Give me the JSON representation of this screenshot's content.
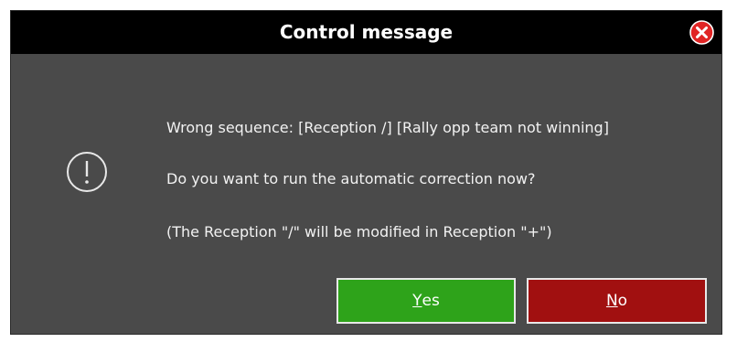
{
  "dialog": {
    "title": "Control message",
    "messages": [
      "Wrong sequence: [Reception /]  [Rally opp team not winning]",
      "Do you want to run the automatic correction now?",
      "(The Reception \"/\" will be modified in Reception \"+\")"
    ],
    "buttons": {
      "yes_accel": "Y",
      "yes_rest": "es",
      "no_accel": "N",
      "no_rest": "o"
    },
    "icons": {
      "close": "close-icon",
      "info": "exclamation-icon"
    },
    "colors": {
      "titlebar": "#000000",
      "body": "#4a4a4a",
      "yes": "#2ea31a",
      "no": "#a11010",
      "close": "#e02424"
    }
  }
}
